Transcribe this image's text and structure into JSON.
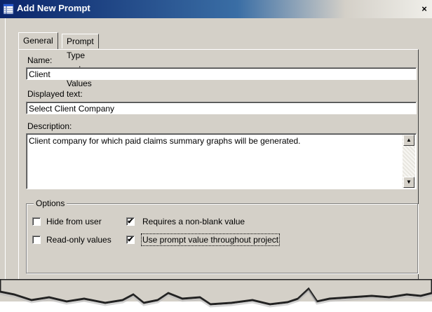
{
  "window": {
    "title": "Add New Prompt",
    "close_glyph": "×"
  },
  "tabs": [
    {
      "label": "General",
      "active": true
    },
    {
      "label": "Prompt Type and Values",
      "active": false
    }
  ],
  "fields": {
    "name": {
      "label": "Name:",
      "value": "Client"
    },
    "displayed_text": {
      "label": "Displayed text:",
      "value": "Select Client Company"
    },
    "description": {
      "label": "Description:",
      "value": "Client company for which paid claims summary graphs will be generated."
    }
  },
  "options": {
    "title": "Options",
    "items": [
      {
        "label": "Hide from user",
        "checked": false
      },
      {
        "label": "Requires a non-blank value",
        "checked": true
      },
      {
        "label": "Read-only values",
        "checked": false
      },
      {
        "label": "Use prompt value throughout project",
        "checked": true
      }
    ]
  },
  "scrollbar": {
    "up_glyph": "▲",
    "down_glyph": "▼"
  },
  "colors": {
    "dialog_bg": "#d4d0c8",
    "title_dark": "#0a246a",
    "title_light": "#3a6ea5"
  },
  "icons": {
    "title": "window-grid-icon",
    "close": "close-icon"
  }
}
